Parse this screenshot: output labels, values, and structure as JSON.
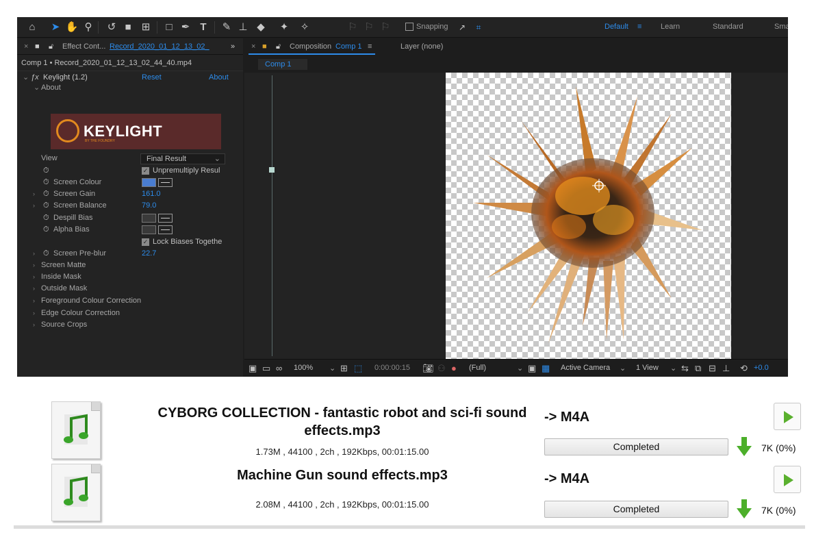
{
  "toolbar": {
    "snapping_label": "Snapping",
    "workspaces": [
      "Default",
      "Learn",
      "Standard",
      "Sma"
    ],
    "active_workspace": "Default"
  },
  "left_panel": {
    "tab_title": "Effect Cont...",
    "tab_layer": "Record_2020_01_12_13_02_",
    "subheader": "Comp 1 • Record_2020_01_12_13_02_44_40.mp4",
    "effect_name": "Keylight (1.2)",
    "reset_label": "Reset",
    "about_label": "About",
    "about_group": "About",
    "logo_text": "KEYLIGHT",
    "logo_sub": "BY THE FOUNDRY",
    "view_label": "View",
    "view_value": "Final Result",
    "unpremultiply_label": "Unpremultiply Resul",
    "screen_colour_label": "Screen Colour",
    "screen_gain_label": "Screen Gain",
    "screen_gain_value": "161.0",
    "screen_balance_label": "Screen Balance",
    "screen_balance_value": "79.0",
    "despill_bias_label": "Despill Bias",
    "alpha_bias_label": "Alpha Bias",
    "lock_biases_label": "Lock Biases Togethe",
    "screen_preblur_label": "Screen Pre-blur",
    "screen_preblur_value": "22.7",
    "groups": [
      "Screen Matte",
      "Inside Mask",
      "Outside Mask",
      "Foreground Colour Correction",
      "Edge Colour Correction",
      "Source Crops"
    ],
    "accent_color": "#2d8ceb"
  },
  "comp_panel": {
    "tab_prefix": "Composition",
    "tab_comp": "Comp 1",
    "layer_label": "Layer  (none)",
    "comp_chip": "Comp 1",
    "zoom": "100%",
    "timecode": "0:00:00:15",
    "resolution": "(Full)",
    "camera": "Active Camera",
    "views": "1 View",
    "exposure": "+0.0"
  },
  "files": [
    {
      "title": "CYBORG COLLECTION - fantastic robot and sci-fi sound effects.mp3",
      "meta": "1.73M , 44100 , 2ch , 192Kbps, 00:01:15.00",
      "format": "-> M4A",
      "status": "Completed",
      "size": "7K  (0%)",
      "progress": 1.0
    },
    {
      "title": "Machine Gun sound effects.mp3",
      "meta": "2.08M , 44100 , 2ch , 192Kbps, 00:01:15.00",
      "format": "-> M4A",
      "status": "Completed",
      "size": "7K  (0%)",
      "progress": 1.0
    }
  ],
  "icons": [
    "home-icon",
    "selection-tool-icon",
    "hand-tool-icon",
    "zoom-tool-icon",
    "rotate-tool-icon",
    "camera-tool-icon",
    "pan-behind-icon",
    "rectangle-tool-icon",
    "pen-tool-icon",
    "type-tool-icon",
    "brush-tool-icon",
    "clone-stamp-icon",
    "eraser-icon",
    "roto-brush-icon",
    "puppet-pin-icon",
    "music-note-icon",
    "play-icon",
    "down-arrow-icon"
  ],
  "colors": {
    "ae_bg": "#1d1d1d",
    "accent": "#2d8ceb",
    "play_green": "#5ab02e"
  }
}
